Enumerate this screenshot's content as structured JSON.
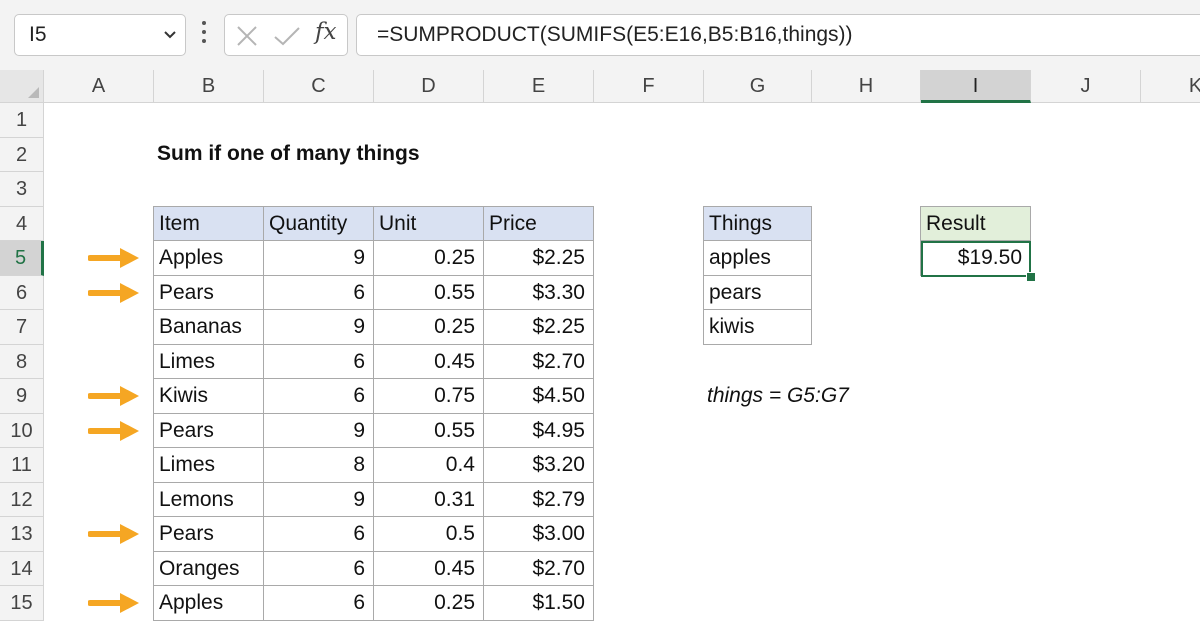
{
  "name_box": {
    "value": "I5"
  },
  "formula_bar": {
    "fx_label": "fx",
    "formula": "=SUMPRODUCT(SUMIFS(E5:E16,B5:B16,things))"
  },
  "columns": [
    "A",
    "B",
    "C",
    "D",
    "E",
    "F",
    "G",
    "H",
    "I",
    "J",
    "K"
  ],
  "selected_column": "I",
  "rows": [
    "1",
    "2",
    "3",
    "4",
    "5",
    "6",
    "7",
    "8",
    "9",
    "10",
    "11",
    "12",
    "13",
    "14",
    "15"
  ],
  "selected_row": "5",
  "sheet": {
    "title": "Sum if one of many things",
    "table": {
      "headers": [
        "Item",
        "Quantity",
        "Unit",
        "Price"
      ],
      "rows": [
        [
          "Apples",
          "9",
          "0.25",
          "$2.25"
        ],
        [
          "Pears",
          "6",
          "0.55",
          "$3.30"
        ],
        [
          "Bananas",
          "9",
          "0.25",
          "$2.25"
        ],
        [
          "Limes",
          "6",
          "0.45",
          "$2.70"
        ],
        [
          "Kiwis",
          "6",
          "0.75",
          "$4.50"
        ],
        [
          "Pears",
          "9",
          "0.55",
          "$4.95"
        ],
        [
          "Limes",
          "8",
          "0.4",
          "$3.20"
        ],
        [
          "Lemons",
          "9",
          "0.31",
          "$2.79"
        ],
        [
          "Pears",
          "6",
          "0.5",
          "$3.00"
        ],
        [
          "Oranges",
          "6",
          "0.45",
          "$2.70"
        ],
        [
          "Apples",
          "6",
          "0.25",
          "$1.50"
        ]
      ]
    },
    "things": {
      "header": "Things",
      "items": [
        "apples",
        "pears",
        "kiwis"
      ]
    },
    "result": {
      "header": "Result",
      "value": "$19.50"
    },
    "named_range_note": "things = G5:G7",
    "arrow_rows": [
      "5",
      "6",
      "9",
      "10",
      "13",
      "15"
    ],
    "colors": {
      "accent_green": "#217346",
      "arrow_orange": "#f5a623",
      "header_blue": "#d9e1f2",
      "header_green": "#e2efda"
    }
  }
}
